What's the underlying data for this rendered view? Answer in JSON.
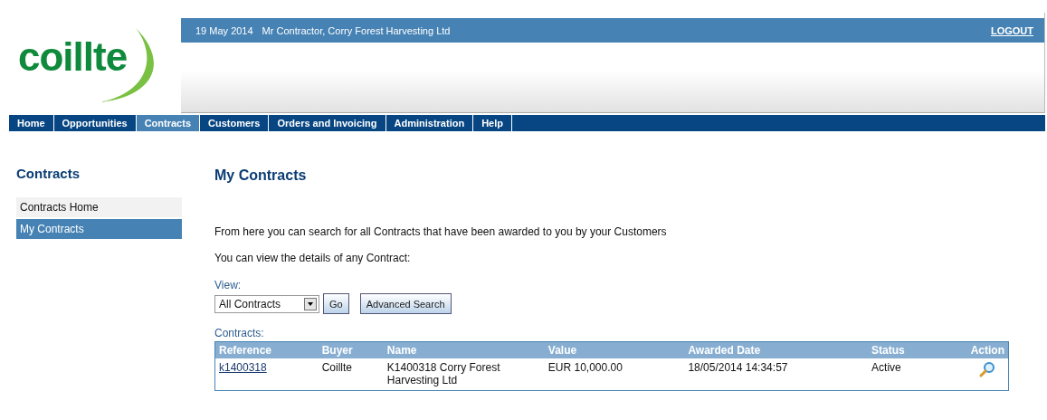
{
  "logo": {
    "text": "coillte"
  },
  "header": {
    "date": "19 May 2014",
    "user": "Mr Contractor, Corry Forest Harvesting Ltd",
    "logout": "LOGOUT"
  },
  "nav": [
    {
      "label": "Home",
      "selected": false
    },
    {
      "label": "Opportunities",
      "selected": false
    },
    {
      "label": "Contracts",
      "selected": true
    },
    {
      "label": "Customers",
      "selected": false
    },
    {
      "label": "Orders and Invoicing",
      "selected": false
    },
    {
      "label": "Administration",
      "selected": false
    },
    {
      "label": "Help",
      "selected": false
    }
  ],
  "sidebar": {
    "title": "Contracts",
    "items": [
      {
        "label": "Contracts Home",
        "selected": false
      },
      {
        "label": "My Contracts",
        "selected": true
      }
    ]
  },
  "main": {
    "title": "My Contracts",
    "intro": "From here you can search for all Contracts that have been awarded to you by your Customers",
    "hint": "You can view the details of any Contract:",
    "view_label": "View:",
    "view_value": "All Contracts",
    "go": "Go",
    "advanced": "Advanced Search"
  },
  "table": {
    "caption": "Contracts:",
    "columns": [
      "Reference",
      "Buyer",
      "Name",
      "Value",
      "Awarded Date",
      "Status",
      "Action"
    ],
    "rows": [
      {
        "reference": "k1400318",
        "buyer": "Coillte",
        "name": "K1400318 Corry Forest Harvesting Ltd",
        "value": "EUR 10,000.00",
        "awarded": "18/05/2014 14:34:57",
        "status": "Active"
      }
    ]
  }
}
